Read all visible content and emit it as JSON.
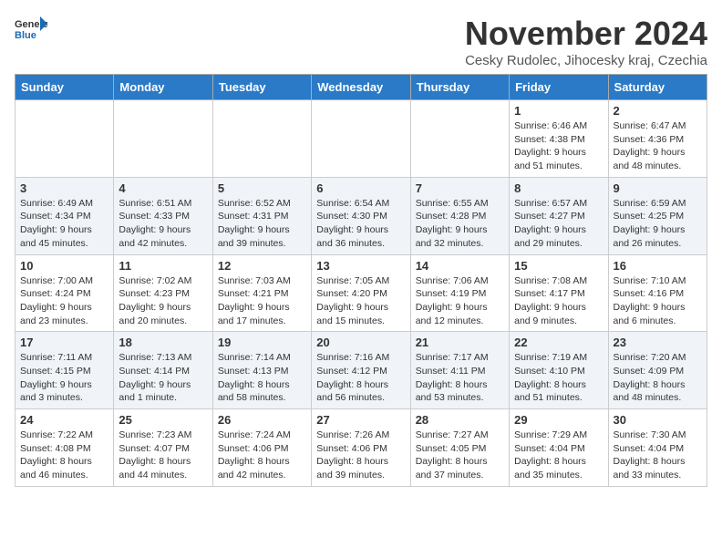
{
  "logo": {
    "general": "General",
    "blue": "Blue"
  },
  "title": "November 2024",
  "subtitle": "Cesky Rudolec, Jihocesky kraj, Czechia",
  "headers": [
    "Sunday",
    "Monday",
    "Tuesday",
    "Wednesday",
    "Thursday",
    "Friday",
    "Saturday"
  ],
  "weeks": [
    [
      {
        "day": "",
        "info": ""
      },
      {
        "day": "",
        "info": ""
      },
      {
        "day": "",
        "info": ""
      },
      {
        "day": "",
        "info": ""
      },
      {
        "day": "",
        "info": ""
      },
      {
        "day": "1",
        "info": "Sunrise: 6:46 AM\nSunset: 4:38 PM\nDaylight: 9 hours\nand 51 minutes."
      },
      {
        "day": "2",
        "info": "Sunrise: 6:47 AM\nSunset: 4:36 PM\nDaylight: 9 hours\nand 48 minutes."
      }
    ],
    [
      {
        "day": "3",
        "info": "Sunrise: 6:49 AM\nSunset: 4:34 PM\nDaylight: 9 hours\nand 45 minutes."
      },
      {
        "day": "4",
        "info": "Sunrise: 6:51 AM\nSunset: 4:33 PM\nDaylight: 9 hours\nand 42 minutes."
      },
      {
        "day": "5",
        "info": "Sunrise: 6:52 AM\nSunset: 4:31 PM\nDaylight: 9 hours\nand 39 minutes."
      },
      {
        "day": "6",
        "info": "Sunrise: 6:54 AM\nSunset: 4:30 PM\nDaylight: 9 hours\nand 36 minutes."
      },
      {
        "day": "7",
        "info": "Sunrise: 6:55 AM\nSunset: 4:28 PM\nDaylight: 9 hours\nand 32 minutes."
      },
      {
        "day": "8",
        "info": "Sunrise: 6:57 AM\nSunset: 4:27 PM\nDaylight: 9 hours\nand 29 minutes."
      },
      {
        "day": "9",
        "info": "Sunrise: 6:59 AM\nSunset: 4:25 PM\nDaylight: 9 hours\nand 26 minutes."
      }
    ],
    [
      {
        "day": "10",
        "info": "Sunrise: 7:00 AM\nSunset: 4:24 PM\nDaylight: 9 hours\nand 23 minutes."
      },
      {
        "day": "11",
        "info": "Sunrise: 7:02 AM\nSunset: 4:23 PM\nDaylight: 9 hours\nand 20 minutes."
      },
      {
        "day": "12",
        "info": "Sunrise: 7:03 AM\nSunset: 4:21 PM\nDaylight: 9 hours\nand 17 minutes."
      },
      {
        "day": "13",
        "info": "Sunrise: 7:05 AM\nSunset: 4:20 PM\nDaylight: 9 hours\nand 15 minutes."
      },
      {
        "day": "14",
        "info": "Sunrise: 7:06 AM\nSunset: 4:19 PM\nDaylight: 9 hours\nand 12 minutes."
      },
      {
        "day": "15",
        "info": "Sunrise: 7:08 AM\nSunset: 4:17 PM\nDaylight: 9 hours\nand 9 minutes."
      },
      {
        "day": "16",
        "info": "Sunrise: 7:10 AM\nSunset: 4:16 PM\nDaylight: 9 hours\nand 6 minutes."
      }
    ],
    [
      {
        "day": "17",
        "info": "Sunrise: 7:11 AM\nSunset: 4:15 PM\nDaylight: 9 hours\nand 3 minutes."
      },
      {
        "day": "18",
        "info": "Sunrise: 7:13 AM\nSunset: 4:14 PM\nDaylight: 9 hours\nand 1 minute."
      },
      {
        "day": "19",
        "info": "Sunrise: 7:14 AM\nSunset: 4:13 PM\nDaylight: 8 hours\nand 58 minutes."
      },
      {
        "day": "20",
        "info": "Sunrise: 7:16 AM\nSunset: 4:12 PM\nDaylight: 8 hours\nand 56 minutes."
      },
      {
        "day": "21",
        "info": "Sunrise: 7:17 AM\nSunset: 4:11 PM\nDaylight: 8 hours\nand 53 minutes."
      },
      {
        "day": "22",
        "info": "Sunrise: 7:19 AM\nSunset: 4:10 PM\nDaylight: 8 hours\nand 51 minutes."
      },
      {
        "day": "23",
        "info": "Sunrise: 7:20 AM\nSunset: 4:09 PM\nDaylight: 8 hours\nand 48 minutes."
      }
    ],
    [
      {
        "day": "24",
        "info": "Sunrise: 7:22 AM\nSunset: 4:08 PM\nDaylight: 8 hours\nand 46 minutes."
      },
      {
        "day": "25",
        "info": "Sunrise: 7:23 AM\nSunset: 4:07 PM\nDaylight: 8 hours\nand 44 minutes."
      },
      {
        "day": "26",
        "info": "Sunrise: 7:24 AM\nSunset: 4:06 PM\nDaylight: 8 hours\nand 42 minutes."
      },
      {
        "day": "27",
        "info": "Sunrise: 7:26 AM\nSunset: 4:06 PM\nDaylight: 8 hours\nand 39 minutes."
      },
      {
        "day": "28",
        "info": "Sunrise: 7:27 AM\nSunset: 4:05 PM\nDaylight: 8 hours\nand 37 minutes."
      },
      {
        "day": "29",
        "info": "Sunrise: 7:29 AM\nSunset: 4:04 PM\nDaylight: 8 hours\nand 35 minutes."
      },
      {
        "day": "30",
        "info": "Sunrise: 7:30 AM\nSunset: 4:04 PM\nDaylight: 8 hours\nand 33 minutes."
      }
    ]
  ]
}
